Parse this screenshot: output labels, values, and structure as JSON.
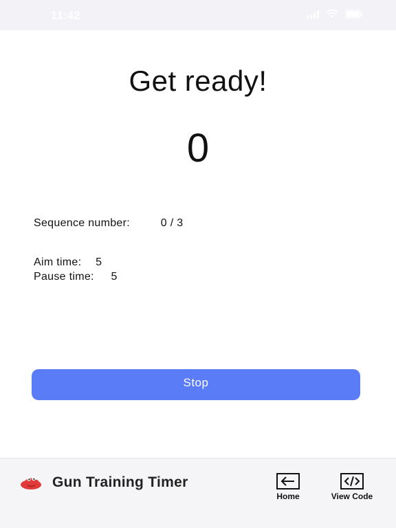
{
  "status_bar": {
    "time": "11:42"
  },
  "main": {
    "title": "Get ready!",
    "counter": "0",
    "sequence": {
      "label": "Sequence number:",
      "value": "0 / 3"
    },
    "aim": {
      "label": "Aim time:",
      "value": "5"
    },
    "pause": {
      "label": "Pause time:",
      "value": "5"
    },
    "stop_label": "Stop"
  },
  "footer": {
    "app_name": "Gun Training Timer",
    "home_label": "Home",
    "view_code_label": "View Code"
  },
  "colors": {
    "accent": "#5b7cf7",
    "logo": "#e03a3a"
  }
}
